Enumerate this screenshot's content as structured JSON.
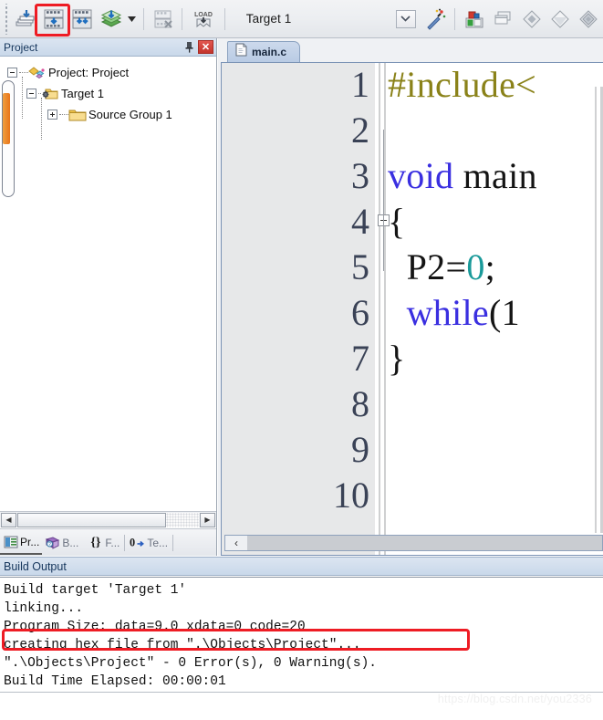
{
  "toolbar": {
    "buttons": [
      {
        "name": "translate-icon",
        "title": "Translate"
      },
      {
        "name": "build-icon",
        "title": "Build"
      },
      {
        "name": "rebuild-icon",
        "title": "Rebuild"
      },
      {
        "name": "batch-build-icon",
        "title": "Batch Build"
      },
      {
        "name": "stop-build-icon",
        "title": "Stop Build"
      },
      {
        "name": "load-icon",
        "title": "Download"
      }
    ],
    "target_value": "Target 1",
    "dropdown_glyph": "⌄",
    "wand_icon": "magic-wand-icon",
    "right_icons": [
      {
        "name": "manage-components-icon"
      },
      {
        "name": "windows-icon"
      },
      {
        "name": "diamond-icon"
      },
      {
        "name": "diamond-light-icon"
      },
      {
        "name": "diamond-multi-icon"
      }
    ],
    "highlight_color": "#ee1c24"
  },
  "project_panel": {
    "title": "Project",
    "pin_glyph": "⚑",
    "close_glyph": "✕",
    "tree": [
      {
        "label": "Project: Project",
        "icon": "project-icon",
        "expander": "minus",
        "depth": 0
      },
      {
        "label": "Target 1",
        "icon": "target-folder-icon",
        "expander": "minus",
        "depth": 1
      },
      {
        "label": "Source Group 1",
        "icon": "folder-icon",
        "expander": "plus",
        "depth": 2
      }
    ],
    "tabs": [
      {
        "label": "Pr...",
        "icon": "project-window-icon",
        "active": true
      },
      {
        "label": "B...",
        "icon": "books-icon",
        "active": false
      },
      {
        "label": "F...",
        "icon": "braces-icon",
        "active": false
      },
      {
        "label": "Te...",
        "icon": "templates-icon",
        "active": false
      }
    ],
    "scroll_left_glyph": "◀",
    "scroll_right_glyph": "▶",
    "thumb_color": "#e8741a"
  },
  "editor": {
    "tab": {
      "label": "main.c",
      "icon": "c-file-icon"
    },
    "scroll_left_glyph": "‹",
    "lines": [
      {
        "num": "1",
        "tokens": [
          {
            "t": "#include<",
            "c": "pp"
          }
        ],
        "fold": false
      },
      {
        "num": "2",
        "tokens": [],
        "fold": false
      },
      {
        "num": "3",
        "tokens": [
          {
            "t": "void",
            "c": "kw"
          },
          {
            "t": " main",
            "c": "pl"
          }
        ],
        "fold": false
      },
      {
        "num": "4",
        "tokens": [
          {
            "t": "{",
            "c": "pl"
          }
        ],
        "fold": true
      },
      {
        "num": "5",
        "tokens": [
          {
            "t": "  P2=",
            "c": "pl"
          },
          {
            "t": "0",
            "c": "num"
          },
          {
            "t": ";",
            "c": "pl"
          }
        ],
        "fold": false
      },
      {
        "num": "6",
        "tokens": [
          {
            "t": "  ",
            "c": "pl"
          },
          {
            "t": "while",
            "c": "kw"
          },
          {
            "t": "(1",
            "c": "pl"
          }
        ],
        "fold": false
      },
      {
        "num": "7",
        "tokens": [
          {
            "t": "}",
            "c": "pl"
          }
        ],
        "fold": false
      },
      {
        "num": "8",
        "tokens": [],
        "fold": false
      },
      {
        "num": "9",
        "tokens": [],
        "fold": false
      },
      {
        "num": "10",
        "tokens": [],
        "fold": false
      }
    ]
  },
  "build_output": {
    "title": "Build Output",
    "lines": [
      "Build target 'Target 1'",
      "linking...",
      "Program Size: data=9.0 xdata=0 code=20",
      "creating hex file from \".\\Objects\\Project\"...",
      "\".\\Objects\\Project\" - 0 Error(s), 0 Warning(s).",
      "Build Time Elapsed:  00:00:01"
    ],
    "highlighted_line_index": 3,
    "highlight_color": "#ee1c24"
  },
  "watermark": "https://blog.csdn.net/you2336"
}
